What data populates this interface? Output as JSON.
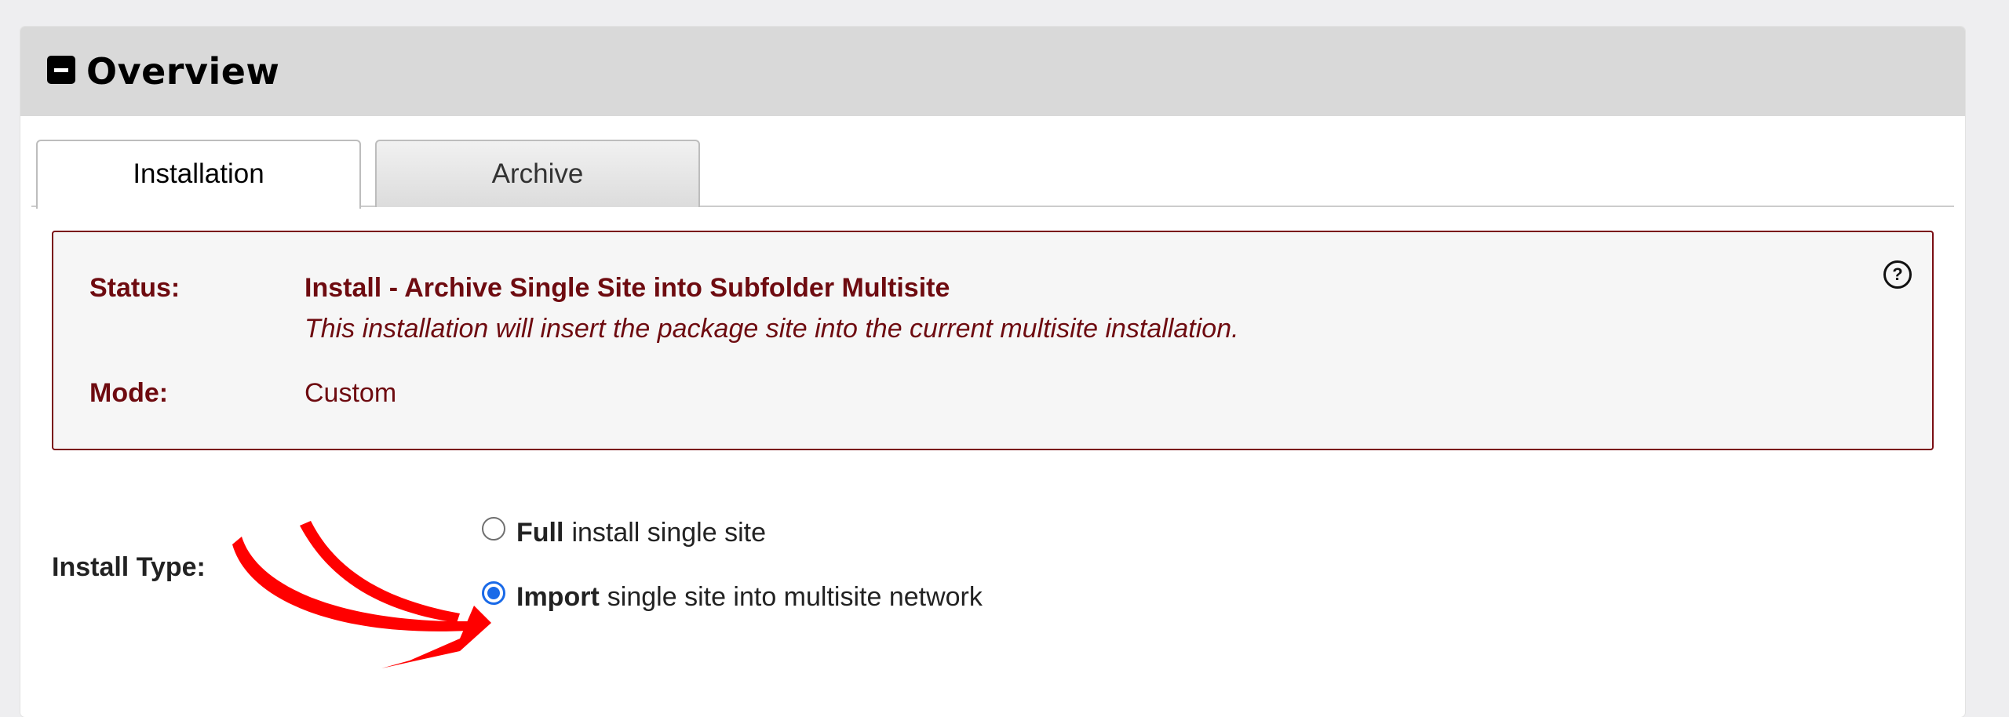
{
  "panel": {
    "title": "Overview"
  },
  "tabs": [
    {
      "label": "Installation",
      "active": true
    },
    {
      "label": "Archive",
      "active": false
    }
  ],
  "status": {
    "status_label": "Status:",
    "status_value": "Install - Archive Single Site into Subfolder Multisite",
    "status_description": "This installation will insert the package site into the current multisite installation.",
    "mode_label": "Mode:",
    "mode_value": "Custom",
    "help_icon": "?"
  },
  "install_type": {
    "label": "Install Type:",
    "options": [
      {
        "bold": "Full",
        "text": "install single site",
        "checked": false
      },
      {
        "bold": "Import",
        "text": "single site into multisite network",
        "checked": true
      }
    ]
  },
  "colors": {
    "status_text": "#6e0b10",
    "radio_checked": "#1a6ae8",
    "annotation_arrow": "#ff0000"
  }
}
